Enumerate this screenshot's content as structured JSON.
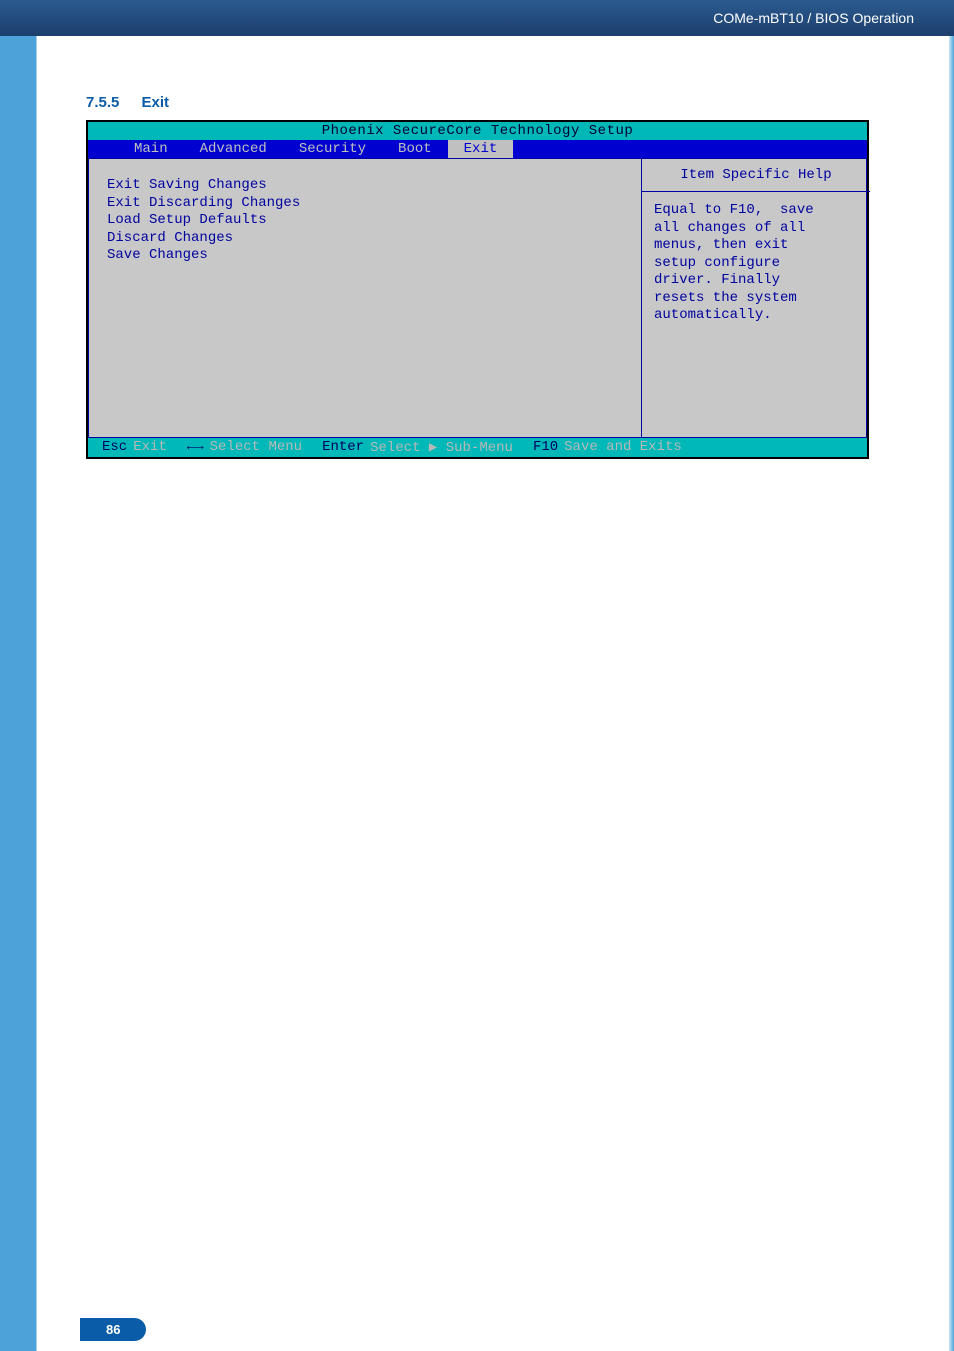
{
  "header": {
    "breadcrumb": "COMe-mBT10 / BIOS Operation"
  },
  "section": {
    "number": "7.5.5",
    "title": "Exit"
  },
  "bios": {
    "title": "Phoenix SecureCore Technology Setup",
    "tabs": [
      "Main",
      "Advanced",
      "Security",
      "Boot",
      "Exit"
    ],
    "active_tab": "Exit",
    "menu_items": [
      "Exit Saving Changes",
      "Exit Discarding Changes",
      "Load Setup Defaults",
      "Discard Changes",
      "Save Changes"
    ],
    "help": {
      "title": "Item Specific Help",
      "body": "Equal to F10,  save\nall changes of all\nmenus, then exit\nsetup configure\ndriver. Finally\nresets the system\nautomatically."
    },
    "footer": [
      {
        "key": "Esc",
        "label": "Exit"
      },
      {
        "key": "←→",
        "label": "Select Menu"
      },
      {
        "key": "Enter",
        "label": "Select ▶ Sub-Menu"
      },
      {
        "key": "F10",
        "label": "Save and Exits"
      }
    ]
  },
  "page_number": "86"
}
